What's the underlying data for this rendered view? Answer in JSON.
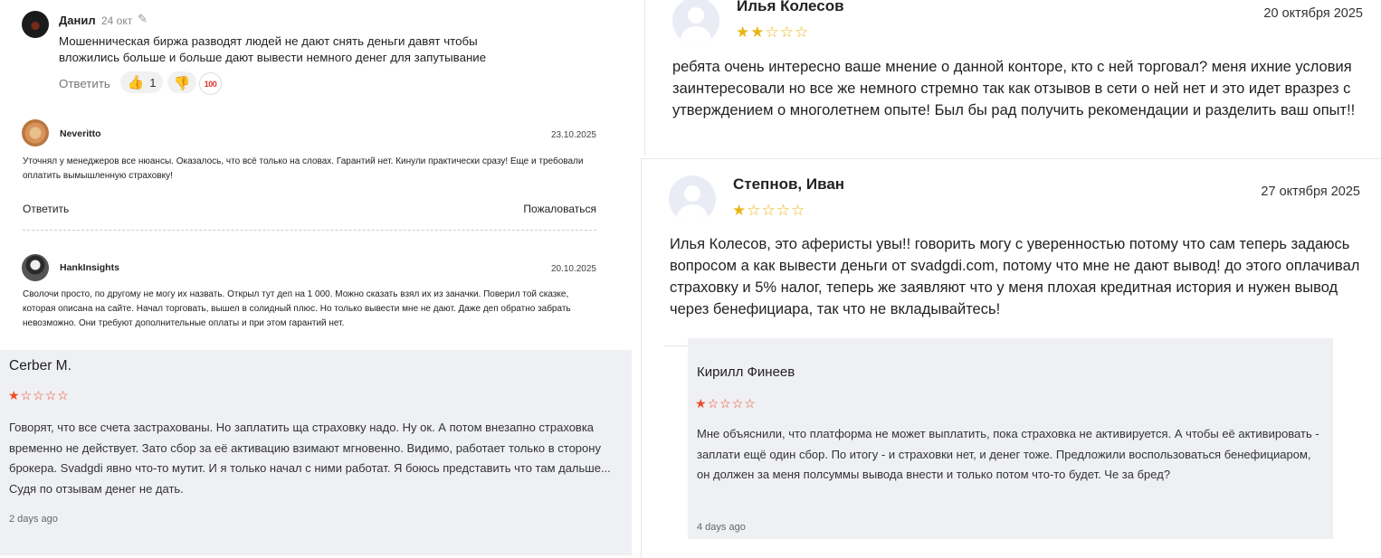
{
  "danil": {
    "name": "Данил",
    "date": "24 окт",
    "edit_icon": "pencil-icon",
    "text": "Мошенническая биржа разводят людей не дают снять деньги давят чтобы вложились больше и больше дают вывести немного денег для запутывание",
    "reply_label": "Ответить",
    "like_count": "1",
    "like_icon": "thumbs-up-icon",
    "dislike_icon": "thumbs-down-icon",
    "hundred_label": "100"
  },
  "neveritto": {
    "name": "Neveritto",
    "date": "23.10.2025",
    "text": "Уточнял у менеджеров все нюансы. Оказалось, что всё только на словах. Гарантий нет. Кинули практически сразу! Еще и требовали оплатить вымышленную страховку!",
    "reply_label": "Ответить",
    "report_label": "Пожаловаться"
  },
  "hank": {
    "name": "HankInsights",
    "date": "20.10.2025",
    "text": "Сволочи просто, по другому не могу их назвать. Открыл тут деп на 1 000. Можно сказать взял их из заначки. Поверил той сказке, которая описана на сайте. Начал торговать, вышел в солидный плюс. Но только вывести мне не дают. Даже деп обратно забрать невозможно. Они требуют дополнительные оплаты и при этом гарантий нет."
  },
  "cerber": {
    "name": "Cerber M.",
    "rating": 1,
    "rating_max": 5,
    "text": "Говорят, что все счета застрахованы. Но заплатить ща страховку надо. Ну ок. А потом внезапно страховка временно не действует. Зато сбор за её активацию взимают мгновенно. Видимо, работает только в сторону брокера. Svadgdi явно что-то мутит. И я только начал с ними работат. Я боюсь представить что там дальше... Судя по отзывам денег не дать.",
    "ago": "2 days ago"
  },
  "ilya": {
    "name": "Илья Колесов",
    "date": "20 октября 2025",
    "rating": 2,
    "rating_max": 5,
    "text": "ребята очень интересно ваше мнение о данной конторе, кто с ней торговал? меня ихние условия заинтересовали но все же немного стремно так как отзывов в сети о ней нет и это идет вразрез с утверждением о многолетнем опыте! Был бы рад получить рекомендации и разделить ваш опыт!!"
  },
  "stepnov": {
    "name": "Степнов, Иван",
    "date": "27 октября 2025",
    "rating": 1,
    "rating_max": 5,
    "text": "Илья Колесов, это аферисты увы!! говорить могу с уверенностью потому что сам теперь задаюсь вопросом а как вывести деньги от svadgdi.com, потому что мне не дают вывод! до этого оплачивал страховку и 5% налог, теперь же заявляют что у меня плохая кредитная история и нужен вывод через бенефициара, так что не вкладывайтесь!"
  },
  "kirill": {
    "name": "Кирилл Финеев",
    "rating": 1,
    "rating_max": 5,
    "text": "Мне объяснили, что платформа не может выплатить, пока страховка не активируется. А чтобы её активировать - заплати ещё один сбор. По итогу - и страховки нет, и денег тоже. Предложили воспользоваться бенефициаром, он должен за меня полсуммы вывода внести и только потом что-то будет. Че за бред?",
    "ago": "4 days ago"
  }
}
